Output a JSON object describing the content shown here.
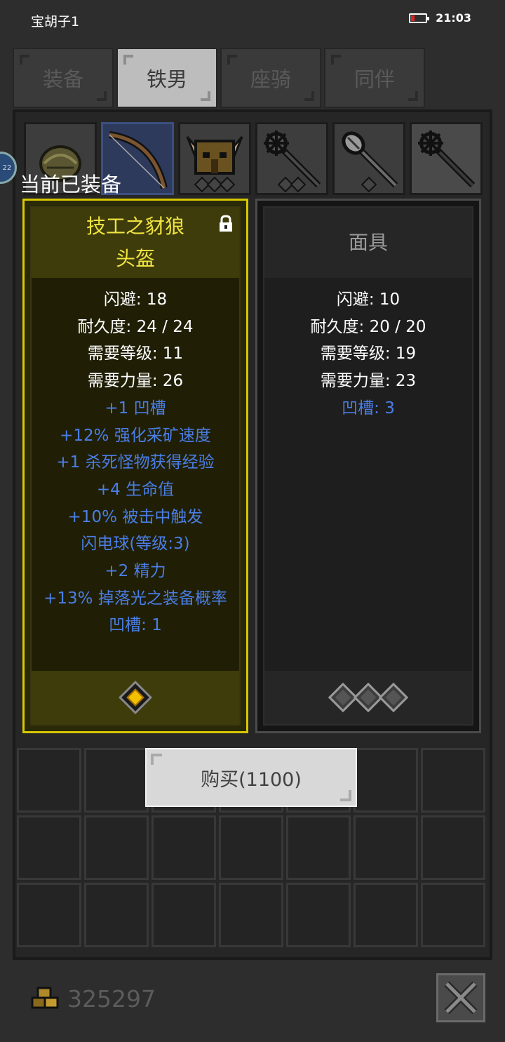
{
  "status_bar": {
    "app_name": "宝胡子1",
    "time": "21:03"
  },
  "tabs": [
    {
      "label": "装备",
      "active": false
    },
    {
      "label": "铁男",
      "active": true
    },
    {
      "label": "座骑",
      "active": false
    },
    {
      "label": "同伴",
      "active": false
    }
  ],
  "equipment_slots": [
    {
      "icon": "helmet-round-icon",
      "sockets": 0
    },
    {
      "icon": "bow-icon",
      "sockets": 0,
      "selected": true
    },
    {
      "icon": "horned-helmet-icon",
      "sockets": 3
    },
    {
      "icon": "mace-icon",
      "sockets": 2
    },
    {
      "icon": "spiked-mace-icon",
      "sockets": 1
    },
    {
      "icon": "mace-icon",
      "sockets": 0
    }
  ],
  "side_badge": "22",
  "equipped_label": "当前已装备",
  "item_left": {
    "title_line1": "技工之豺狼",
    "title_line2": "头盔",
    "stats": [
      "闪避: 18",
      "耐久度: 24 / 24",
      "需要等级: 11",
      "需要力量: 26"
    ],
    "mods": [
      "+1 凹槽",
      "+12% 强化采矿速度",
      "+1 杀死怪物获得经验",
      "+4 生命值",
      "+10% 被击中触发",
      "闪电球(等级:3)",
      "+2 精力",
      "+13% 掉落光之装备概率",
      "凹槽: 1"
    ],
    "border_color": "#d8c800",
    "title_color": "#f0e442"
  },
  "item_right": {
    "title": "面具",
    "stats": [
      "闪避: 10",
      "耐久度: 20 / 20",
      "需要等级: 19",
      "需要力量: 23"
    ],
    "mods": [
      "凹槽: 3"
    ],
    "sockets_empty": 3
  },
  "buy_button": {
    "label": "购买(1100)"
  },
  "coins": {
    "value": "325297"
  },
  "colors": {
    "mod_blue": "#4a7ee6",
    "unique_gold": "#d8c800"
  }
}
